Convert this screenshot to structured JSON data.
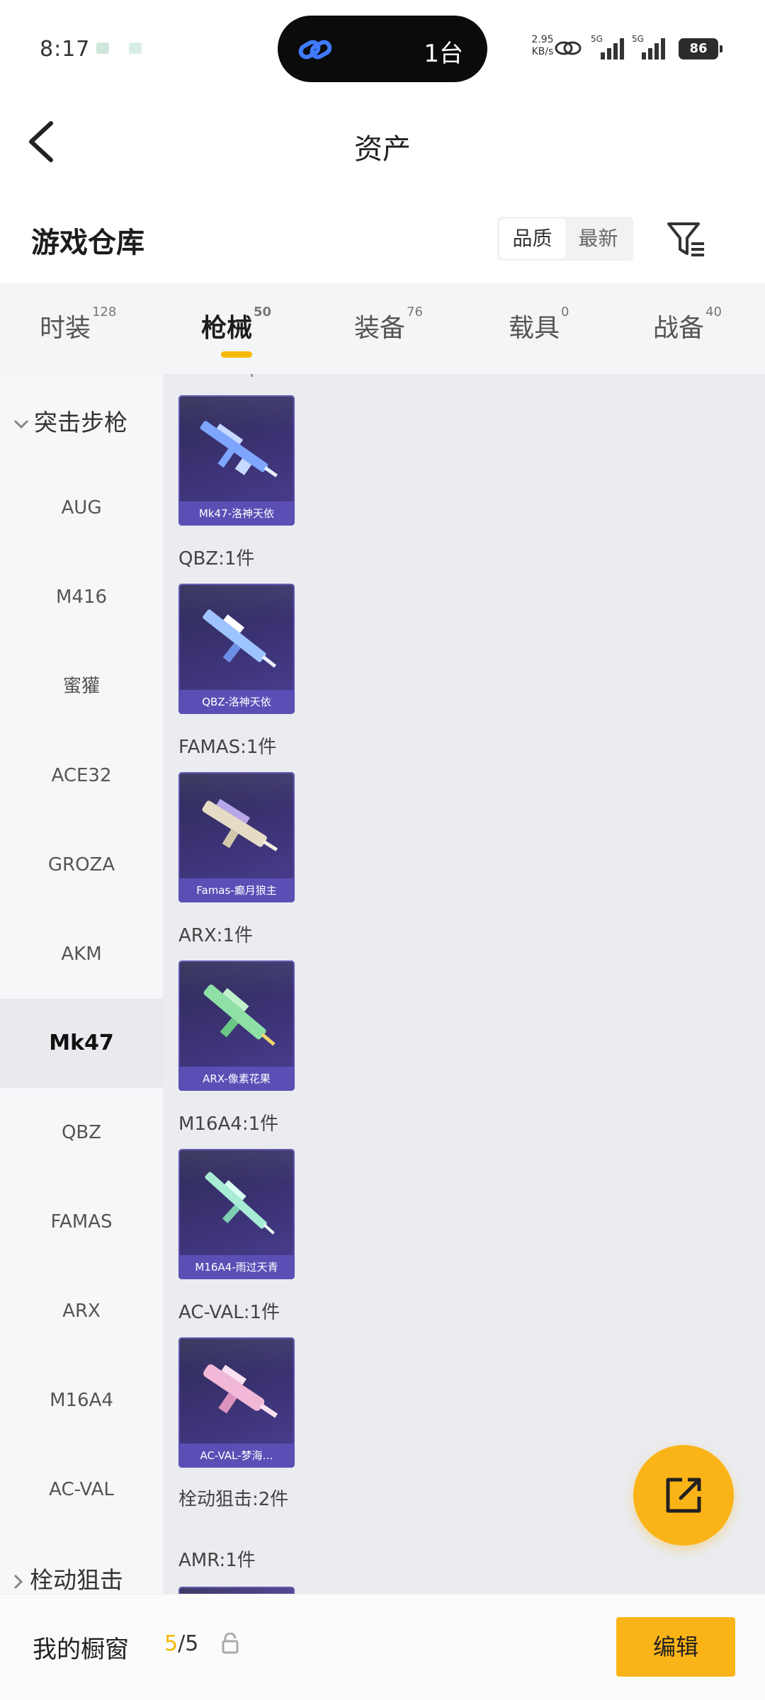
{
  "status_bar": {
    "time": "8:17",
    "island_text": "1台",
    "net_speed_value": "2.95",
    "net_speed_unit": "KB/s",
    "signal_1_label": "5G",
    "signal_2_label": "5G",
    "battery": "86"
  },
  "header": {
    "title": "资产"
  },
  "warehouse": {
    "title": "游戏仓库",
    "sort_options": [
      "品质",
      "最新"
    ],
    "active_sort": "最新"
  },
  "tabs": [
    {
      "label": "时装",
      "count": "128"
    },
    {
      "label": "枪械",
      "count": "50"
    },
    {
      "label": "装备",
      "count": "76"
    },
    {
      "label": "载具",
      "count": "0"
    },
    {
      "label": "战备",
      "count": "40"
    }
  ],
  "active_tab": "枪械",
  "sidenav": {
    "group_1": "突击步枪",
    "items": [
      "AUG",
      "M416",
      "蜜獾",
      "ACE32",
      "GROZA",
      "AKM",
      "Mk47",
      "QBZ",
      "FAMAS",
      "ARX",
      "M16A4",
      "AC-VAL"
    ],
    "active_item": "Mk47",
    "group_2": "栓动狙击"
  },
  "content": {
    "cards": [
      {
        "label": "Mk47-洛神天依",
        "color": "#7ea6ff"
      },
      {
        "label": "QBZ-洛神天依",
        "color": "#9ec4ff"
      },
      {
        "label": "Famas-癫月狼主",
        "color": "#e6dcc6"
      },
      {
        "label": "ARX-像素花果",
        "color": "#8fe0a6"
      },
      {
        "label": "M16A4-雨过天青",
        "color": "#a8ecd6"
      },
      {
        "label": "AC-VAL-梦海…",
        "color": "#f2b8d8"
      }
    ],
    "group_labels": [
      "QBZ:1件",
      "FAMAS:1件",
      "ARX:1件",
      "M16A4:1件",
      "AC-VAL:1件",
      "栓动狙击:2件",
      "AMR:1件"
    ]
  },
  "bottom_bar": {
    "showcase_label": "我的橱窗",
    "showcase_current": "5",
    "showcase_sep": "/",
    "showcase_total": "5",
    "edit_label": "编辑"
  },
  "colors": {
    "accent": "#fbb417",
    "tab_indicator": "#f5b800",
    "card_bg": "#3d3478",
    "card_label_bg": "#5b4fb6"
  },
  "icons": [
    "back-arrow-icon",
    "filter-icon",
    "chevron-down-icon",
    "chevron-right-icon",
    "share-export-icon",
    "lock-icon",
    "link-icon"
  ]
}
